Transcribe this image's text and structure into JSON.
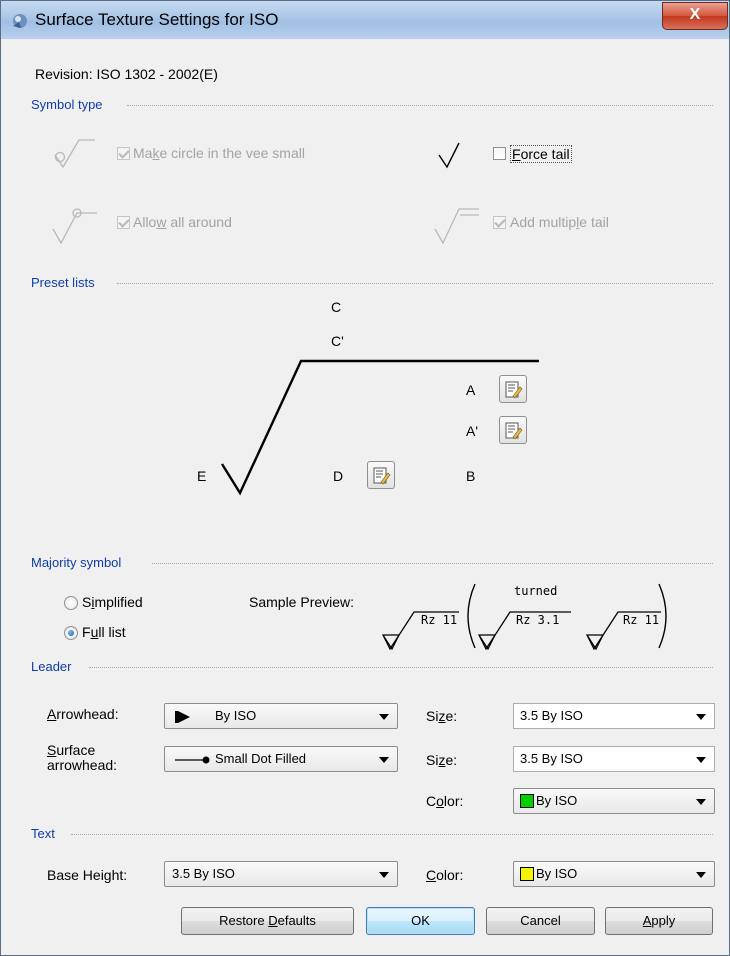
{
  "window": {
    "title": "Surface Texture Settings for ISO",
    "close_label": "X"
  },
  "revision": "Revision: ISO 1302 - 2002(E)",
  "symbol_type": {
    "title": "Symbol type",
    "circle_small": {
      "label_pre": "Ma",
      "label_u": "k",
      "label_post": "e circle in the vee small",
      "checked": true,
      "enabled": false
    },
    "force_tail": {
      "label_pre": "",
      "label_u": "F",
      "label_post": "orce tail",
      "checked": false,
      "enabled": true
    },
    "all_around": {
      "label_pre": "Allo",
      "label_u": "w",
      "label_post": " all around",
      "checked": true,
      "enabled": false
    },
    "multiple_tail": {
      "label_pre": "Add multip",
      "label_u": "l",
      "label_post": "e tail",
      "checked": true,
      "enabled": false
    }
  },
  "preset_lists": {
    "title": "Preset lists",
    "labels": {
      "c": "C",
      "c_prime": "C'",
      "a": "A",
      "a_prime": "A'",
      "b": "B",
      "d": "D",
      "e": "E"
    }
  },
  "majority_symbol": {
    "title": "Majority symbol",
    "simplified": {
      "label_pre": "S",
      "label_u": "i",
      "label_post": "mplified",
      "selected": false
    },
    "full_list": {
      "label_pre": "F",
      "label_u": "u",
      "label_post": "ll list",
      "selected": true
    },
    "preview_label": "Sample Preview:",
    "preview": {
      "left_value": "Rz 11",
      "turned_label": "turned",
      "mid_value": "Rz 3.1",
      "right_value": "Rz 11"
    }
  },
  "leader": {
    "title": "Leader",
    "arrowhead": {
      "label_pre": "",
      "label_u": "A",
      "label_post": "rrowhead:",
      "value": "By ISO"
    },
    "arrowhead_size": {
      "label_pre": "Si",
      "label_u": "z",
      "label_post": "e:",
      "value": "3.5 By ISO"
    },
    "surface_arrowhead": {
      "label_u": "S",
      "label_post": "urface",
      "label_line2": "arrowhead:",
      "value": "Small Dot Filled"
    },
    "surface_size": {
      "label_pre": "Si",
      "label_u": "z",
      "label_post": "e:",
      "value": "3.5 By ISO"
    },
    "color": {
      "label_pre": "C",
      "label_u": "o",
      "label_post": "lor:",
      "value": "By ISO",
      "swatch": "#00d100"
    }
  },
  "text": {
    "title": "Text",
    "base_height": {
      "label": "Base Height:",
      "value": "3.5 By ISO"
    },
    "color": {
      "label_pre": "",
      "label_u": "C",
      "label_post": "olor:",
      "value": "By ISO",
      "swatch": "#f5f500"
    }
  },
  "buttons": {
    "restore": {
      "label_pre": "Restore ",
      "label_u": "D",
      "label_post": "efaults"
    },
    "ok": {
      "label": "OK"
    },
    "cancel": {
      "label": "Cancel"
    },
    "apply": {
      "label_pre": "",
      "label_u": "A",
      "label_post": "pply"
    }
  }
}
